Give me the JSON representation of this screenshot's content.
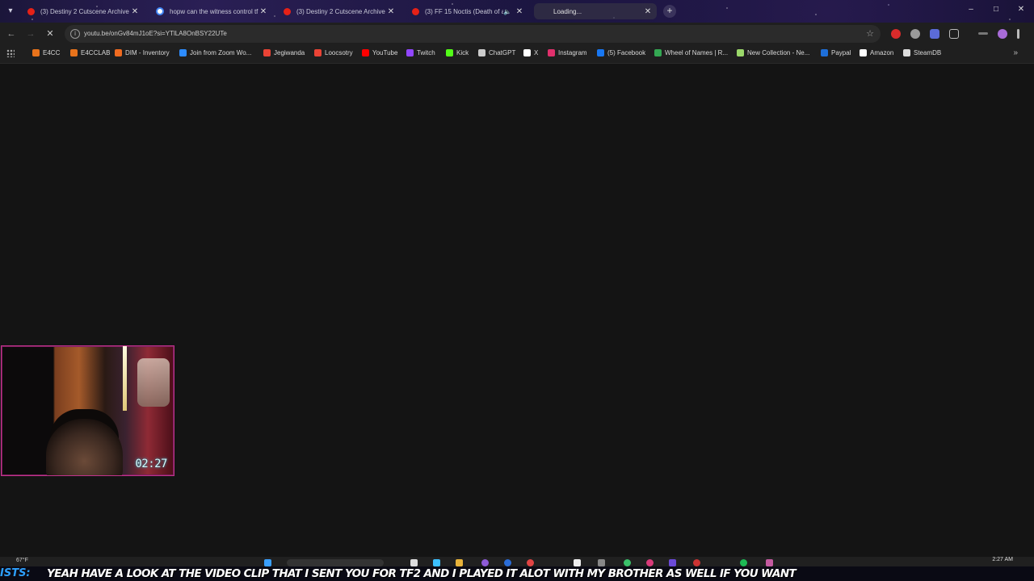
{
  "tabs": [
    {
      "title": "(3) Destiny 2 Cutscene Archive",
      "icon": "youtube-icon",
      "active": false,
      "audio": false
    },
    {
      "title": "hopw can the witness control tf",
      "icon": "google-icon",
      "active": false,
      "audio": false
    },
    {
      "title": "(3) Destiny 2 Cutscene Archive",
      "icon": "youtube-icon",
      "active": false,
      "audio": false
    },
    {
      "title": "(3) FF 15 Noctis (Death of a",
      "icon": "youtube-icon",
      "active": false,
      "audio": true
    },
    {
      "title": "Loading...",
      "icon": "loading-icon",
      "active": true,
      "audio": false
    }
  ],
  "toolbar": {
    "url": "youtu.be/onGv84mJ1oE?si=YTlLA8OnBSY22UTe"
  },
  "bookmarks": [
    {
      "label": "E4CC",
      "color": "#e8731b"
    },
    {
      "label": "E4CCLAB",
      "color": "#e8731b"
    },
    {
      "label": "DIM - Inventory",
      "color": "#f06b20"
    },
    {
      "label": "Join from Zoom Wo...",
      "color": "#2d8cff"
    },
    {
      "label": "Jegiwanda",
      "color": "#ea4335"
    },
    {
      "label": "Loocsotry",
      "color": "#ea4335"
    },
    {
      "label": "YouTube",
      "color": "#ff0000"
    },
    {
      "label": "Twitch",
      "color": "#9146ff"
    },
    {
      "label": "Kick",
      "color": "#53fc18"
    },
    {
      "label": "ChatGPT",
      "color": "#cccccc"
    },
    {
      "label": "X",
      "color": "#ffffff"
    },
    {
      "label": "Instagram",
      "color": "#e1306c"
    },
    {
      "label": "(5) Facebook",
      "color": "#1877f2"
    },
    {
      "label": "Wheel of Names | R...",
      "color": "#34a853"
    },
    {
      "label": "New Collection - Ne...",
      "color": "#9bd86a"
    },
    {
      "label": "Paypal",
      "color": "#1e6fd9"
    },
    {
      "label": "Amazon",
      "color": "#ffffff"
    },
    {
      "label": "SteamDB",
      "color": "#dddddd"
    }
  ],
  "webcam": {
    "timer": "02:27"
  },
  "taskbar": {
    "weather": "67°F",
    "clock": "2:27 AM"
  },
  "ticker": {
    "user": "ISTS:",
    "message": "YEAH HAVE A LOOK AT THE VIDEO CLIP THAT I SENT YOU FOR TF2 AND I PLAYED IT ALOT WITH MY BROTHER AS WELL IF YOU WANT"
  },
  "colors": {
    "accent_webcam_border": "#c0338c",
    "ticker_user": "#2da0ff",
    "page_background": "#141414"
  }
}
